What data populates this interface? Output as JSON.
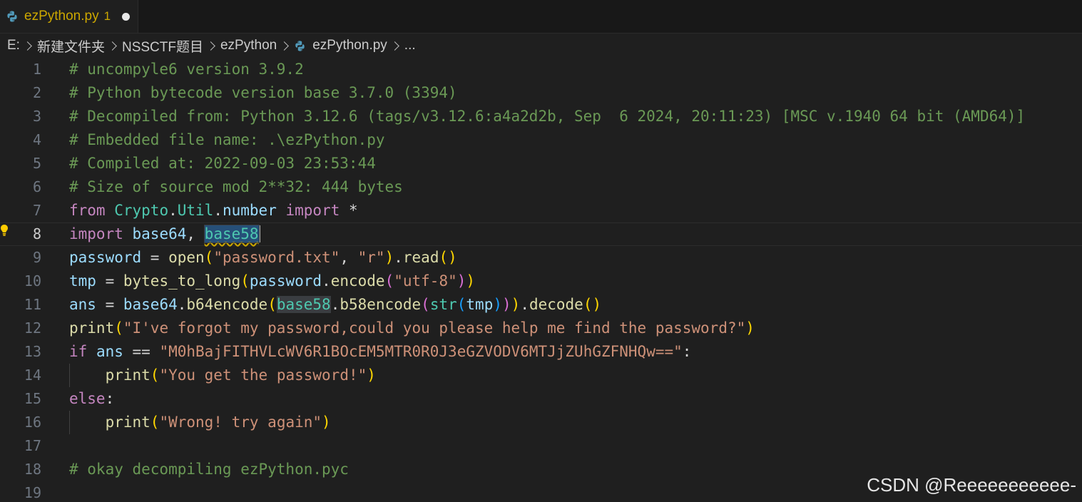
{
  "tab": {
    "title": "ezPython.py",
    "problems": "1",
    "icon": "python-file-icon"
  },
  "breadcrumb": {
    "items": [
      "E:",
      "新建文件夹",
      "NSSCTF题目",
      "ezPython",
      "ezPython.py",
      "..."
    ]
  },
  "editor": {
    "current_line": 8,
    "lines": [
      {
        "n": "1",
        "tokens": [
          [
            "c",
            "# uncompyle6 version 3.9.2"
          ]
        ]
      },
      {
        "n": "2",
        "tokens": [
          [
            "c",
            "# Python bytecode version base 3.7.0 (3394)"
          ]
        ]
      },
      {
        "n": "3",
        "tokens": [
          [
            "c",
            "# Decompiled from: Python 3.12.6 (tags/v3.12.6:a4a2d2b, Sep  6 2024, 20:11:23) [MSC v.1940 64 bit (AMD64)]"
          ]
        ]
      },
      {
        "n": "4",
        "tokens": [
          [
            "c",
            "# Embedded file name: .\\ezPython.py"
          ]
        ]
      },
      {
        "n": "5",
        "tokens": [
          [
            "c",
            "# Compiled at: 2022-09-03 23:53:44"
          ]
        ]
      },
      {
        "n": "6",
        "tokens": [
          [
            "c",
            "# Size of source mod 2**32: 444 bytes"
          ]
        ]
      },
      {
        "n": "7",
        "tokens": [
          [
            "k",
            "from"
          ],
          [
            "o",
            " "
          ],
          [
            "cl",
            "Crypto"
          ],
          [
            "o",
            "."
          ],
          [
            "cl",
            "Util"
          ],
          [
            "o",
            "."
          ],
          [
            "v",
            "number"
          ],
          [
            "o",
            " "
          ],
          [
            "k",
            "import"
          ],
          [
            "o",
            " *"
          ]
        ]
      },
      {
        "n": "8",
        "tokens": [
          [
            "k",
            "import"
          ],
          [
            "o",
            " "
          ],
          [
            "v",
            "base64"
          ],
          [
            "o",
            ", "
          ],
          [
            "sel",
            "base58"
          ],
          [
            "cur",
            ""
          ]
        ]
      },
      {
        "n": "9",
        "tokens": [
          [
            "v",
            "password"
          ],
          [
            "o",
            " = "
          ],
          [
            "f",
            "open"
          ],
          [
            "b1",
            "("
          ],
          [
            "s",
            "\"password.txt\""
          ],
          [
            "o",
            ", "
          ],
          [
            "s",
            "\"r\""
          ],
          [
            "b1",
            ")"
          ],
          [
            "o",
            "."
          ],
          [
            "f",
            "read"
          ],
          [
            "b1",
            "()"
          ]
        ]
      },
      {
        "n": "10",
        "tokens": [
          [
            "v",
            "tmp"
          ],
          [
            "o",
            " = "
          ],
          [
            "f",
            "bytes_to_long"
          ],
          [
            "b1",
            "("
          ],
          [
            "v",
            "password"
          ],
          [
            "o",
            "."
          ],
          [
            "f",
            "encode"
          ],
          [
            "b2",
            "("
          ],
          [
            "s",
            "\"utf-8\""
          ],
          [
            "b2",
            ")"
          ],
          [
            "b1",
            ")"
          ]
        ]
      },
      {
        "n": "11",
        "tokens": [
          [
            "v",
            "ans"
          ],
          [
            "o",
            " = "
          ],
          [
            "v",
            "base64"
          ],
          [
            "o",
            "."
          ],
          [
            "f",
            "b64encode"
          ],
          [
            "b1",
            "("
          ],
          [
            "hw",
            "base58"
          ],
          [
            "o",
            "."
          ],
          [
            "f",
            "b58encode"
          ],
          [
            "b2",
            "("
          ],
          [
            "cl",
            "str"
          ],
          [
            "b3",
            "("
          ],
          [
            "v",
            "tmp"
          ],
          [
            "b3",
            ")"
          ],
          [
            "b2",
            ")"
          ],
          [
            "b1",
            ")"
          ],
          [
            "o",
            "."
          ],
          [
            "f",
            "decode"
          ],
          [
            "b1",
            "()"
          ]
        ]
      },
      {
        "n": "12",
        "tokens": [
          [
            "f",
            "print"
          ],
          [
            "b1",
            "("
          ],
          [
            "s",
            "\"I've forgot my password,could you please help me find the password?\""
          ],
          [
            "b1",
            ")"
          ]
        ]
      },
      {
        "n": "13",
        "tokens": [
          [
            "k",
            "if"
          ],
          [
            "o",
            " "
          ],
          [
            "v",
            "ans"
          ],
          [
            "o",
            " == "
          ],
          [
            "s",
            "\"M0hBajFITHVLcWV6R1BOcEM5MTR0R0J3eGZVODV6MTJjZUhGZFNHQw==\""
          ],
          [
            "o",
            ":"
          ]
        ]
      },
      {
        "n": "14",
        "tokens": [
          [
            "o",
            "    "
          ],
          [
            "f",
            "print"
          ],
          [
            "b1",
            "("
          ],
          [
            "s",
            "\"You get the password!\""
          ],
          [
            "b1",
            ")"
          ]
        ]
      },
      {
        "n": "15",
        "tokens": [
          [
            "k",
            "else"
          ],
          [
            "o",
            ":"
          ]
        ]
      },
      {
        "n": "16",
        "tokens": [
          [
            "o",
            "    "
          ],
          [
            "f",
            "print"
          ],
          [
            "b1",
            "("
          ],
          [
            "s",
            "\"Wrong! try again\""
          ],
          [
            "b1",
            ")"
          ]
        ]
      },
      {
        "n": "17",
        "tokens": []
      },
      {
        "n": "18",
        "tokens": [
          [
            "c",
            "# okay decompiling ezPython.pyc"
          ]
        ]
      },
      {
        "n": "19",
        "tokens": []
      }
    ]
  },
  "watermark": "CSDN @Reeeeeeeeeee-",
  "colors": {
    "comment": "#6a9955",
    "keyword": "#c586c0",
    "variable": "#9cdcfe",
    "class": "#4ec9b0",
    "function": "#dcdcaa",
    "string": "#ce9178",
    "tab_modified": "#cca700"
  }
}
